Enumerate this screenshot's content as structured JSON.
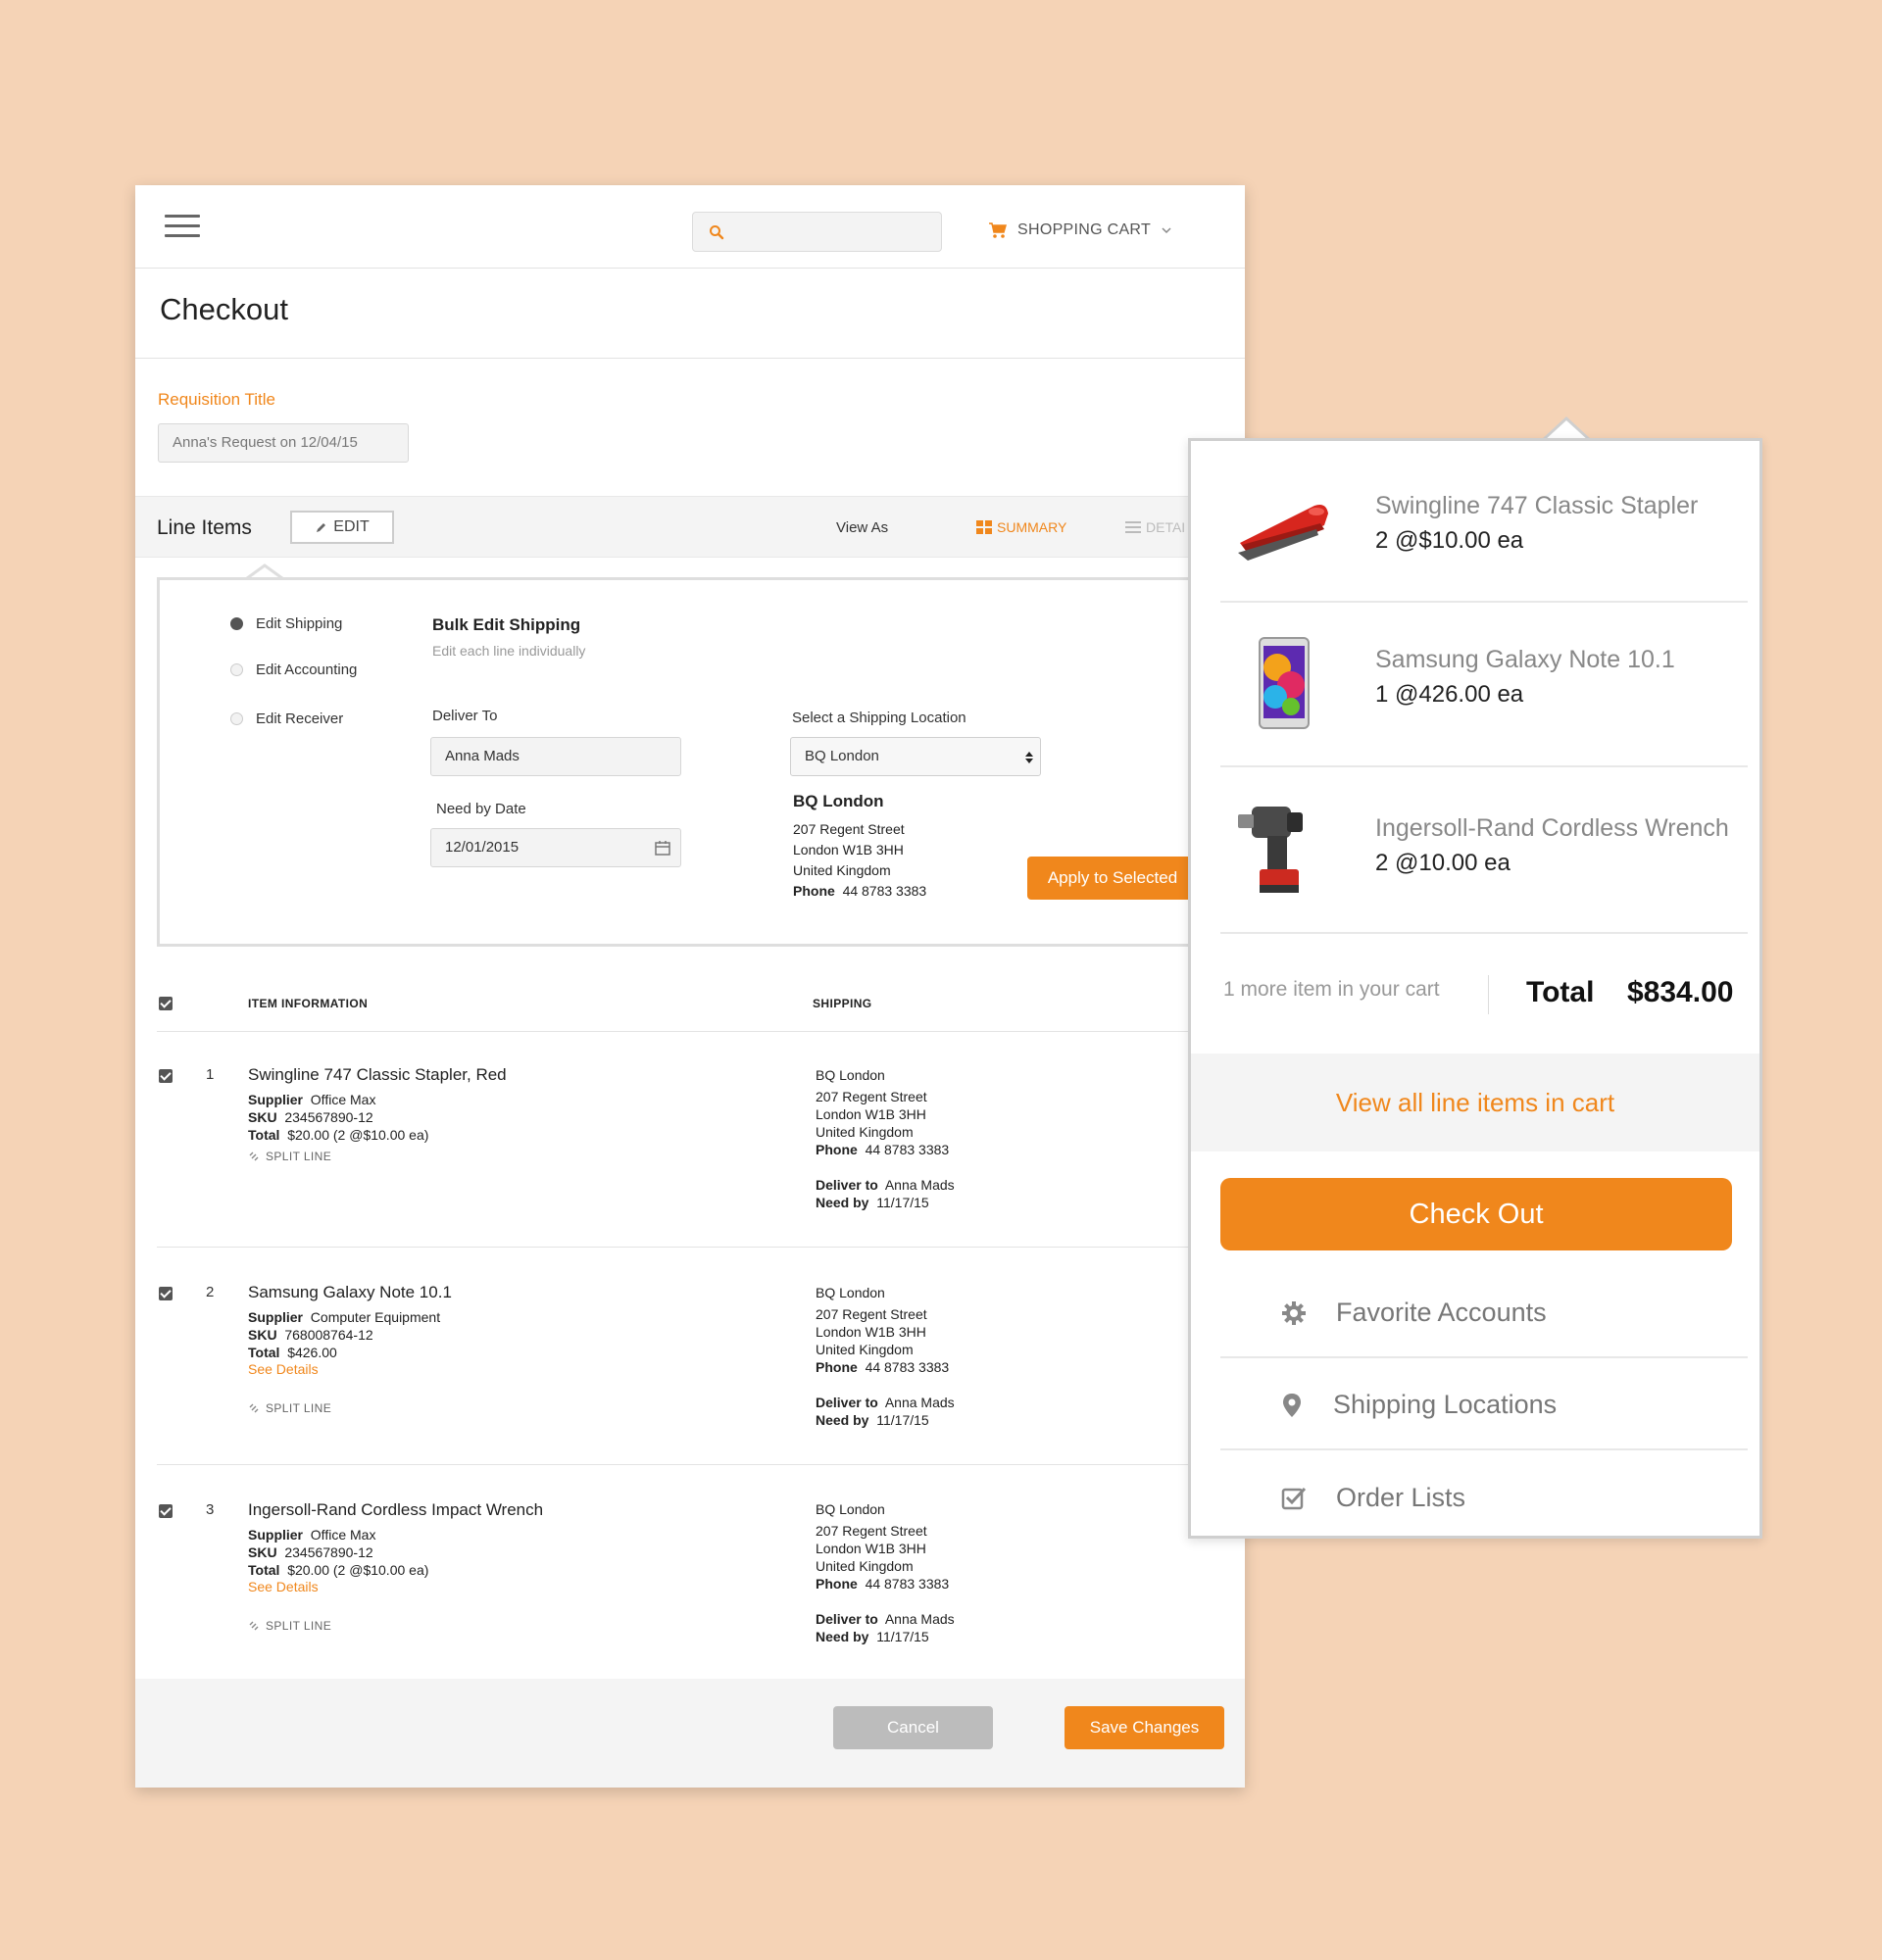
{
  "topbar": {
    "search_placeholder": "",
    "cart_label": "SHOPPING CART"
  },
  "page": {
    "title": "Checkout",
    "requisition_label": "Requisition Title",
    "requisition_value": "Anna's Request on 12/04/15"
  },
  "line_items_bar": {
    "title": "Line Items",
    "edit_label": "EDIT",
    "view_as": "View As",
    "summary": "SUMMARY",
    "detail": "DETAI"
  },
  "bulk": {
    "options": [
      "Edit Shipping",
      "Edit Accounting",
      "Edit Receiver"
    ],
    "title": "Bulk Edit Shipping",
    "subtitle": "Edit each line individually",
    "deliver_label": "Deliver To",
    "deliver_value": "Anna Mads",
    "need_label": "Need by Date",
    "need_value": "12/01/2015",
    "location_label": "Select a Shipping Location",
    "location_value": "BQ London",
    "location_name": "BQ London",
    "address": [
      "207 Regent Street",
      "London W1B 3HH",
      "United Kingdom"
    ],
    "phone_label": "Phone",
    "phone_value": "44 8783 3383",
    "apply_label": "Apply to Selected"
  },
  "table": {
    "col_item": "ITEM INFORMATION",
    "col_shipping": "SHIPPING",
    "rows": [
      {
        "num": "1",
        "name": "Swingline 747 Classic Stapler, Red",
        "supplier_label": "Supplier",
        "supplier": "Office Max",
        "sku_label": "SKU",
        "sku": "234567890-12",
        "total_label": "Total",
        "total": "$20.00 (2 @$10.00 ea)",
        "see_details": "",
        "split": "SPLIT LINE",
        "ship_name": "BQ London",
        "ship_addr1": "207 Regent Street",
        "ship_addr2": "London W1B 3HH",
        "ship_addr3": "United Kingdom",
        "phone_label": "Phone",
        "phone": "44 8783 3383",
        "deliver_label": "Deliver to",
        "deliver": "Anna Mads",
        "need_label": "Need by",
        "need": "11/17/15"
      },
      {
        "num": "2",
        "name": "Samsung Galaxy Note 10.1",
        "supplier_label": "Supplier",
        "supplier": "Computer Equipment",
        "sku_label": "SKU",
        "sku": "768008764-12",
        "total_label": "Total",
        "total": "$426.00",
        "see_details": "See Details",
        "split": "SPLIT LINE",
        "ship_name": "BQ London",
        "ship_addr1": "207 Regent Street",
        "ship_addr2": "London W1B 3HH",
        "ship_addr3": "United Kingdom",
        "phone_label": "Phone",
        "phone": "44 8783 3383",
        "deliver_label": "Deliver to",
        "deliver": "Anna Mads",
        "need_label": "Need by",
        "need": "11/17/15"
      },
      {
        "num": "3",
        "name": "Ingersoll-Rand Cordless Impact Wrench",
        "supplier_label": "Supplier",
        "supplier": "Office Max",
        "sku_label": "SKU",
        "sku": "234567890-12",
        "total_label": "Total",
        "total": "$20.00 (2 @$10.00 ea)",
        "see_details": "See Details",
        "split": "SPLIT LINE",
        "ship_name": "BQ London",
        "ship_addr1": "207 Regent Street",
        "ship_addr2": "London W1B 3HH",
        "ship_addr3": "United Kingdom",
        "phone_label": "Phone",
        "phone": "44 8783 3383",
        "deliver_label": "Deliver to",
        "deliver": "Anna Mads",
        "need_label": "Need by",
        "need": "11/17/15"
      }
    ]
  },
  "footer": {
    "cancel": "Cancel",
    "save": "Save Changes"
  },
  "cart_popup": {
    "items": [
      {
        "name": "Swingline 747 Classic Stapler",
        "qty": "2 @$10.00 ea",
        "icon": "stapler-image"
      },
      {
        "name": "Samsung Galaxy Note 10.1",
        "qty": "1 @426.00 ea",
        "icon": "tablet-image"
      },
      {
        "name": "Ingersoll-Rand Cordless Wrench",
        "qty": "2 @10.00 ea",
        "icon": "wrench-image"
      }
    ],
    "more": "1 more item in your cart",
    "total_label": "Total",
    "total_value": "$834.00",
    "view_all": "View all line items in cart",
    "checkout": "Check Out",
    "links": [
      {
        "label": "Favorite Accounts",
        "icon": "gear-icon"
      },
      {
        "label": "Shipping Locations",
        "icon": "map-pin-icon"
      },
      {
        "label": "Order Lists",
        "icon": "checkbox-icon"
      }
    ]
  },
  "colors": {
    "accent": "#f0871c",
    "background": "#f5d3b6"
  }
}
